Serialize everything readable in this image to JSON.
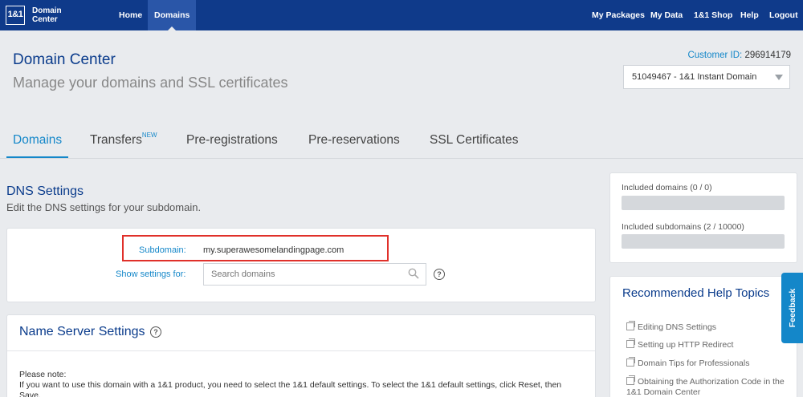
{
  "topnav": {
    "logo": "1&1",
    "brand": "Domain Center",
    "left_items": [
      {
        "label": "Home"
      },
      {
        "label": "Domains",
        "active": true
      }
    ],
    "right_items": [
      {
        "label": "My Packages"
      },
      {
        "label": "My Data"
      },
      {
        "label": "1&1 Shop"
      },
      {
        "label": "Help"
      },
      {
        "label": "Logout"
      }
    ]
  },
  "header": {
    "title": "Domain Center",
    "subtitle": "Manage your domains and SSL certificates",
    "customer_label": "Customer ID:",
    "customer_id": "296914179",
    "package_selected": "51049467 - 1&1 Instant Domain"
  },
  "tabs": [
    {
      "label": "Domains",
      "active": true
    },
    {
      "label": "Transfers",
      "badge": "NEW"
    },
    {
      "label": "Pre-registrations"
    },
    {
      "label": "Pre-reservations"
    },
    {
      "label": "SSL Certificates"
    }
  ],
  "dns": {
    "title": "DNS Settings",
    "description": "Edit the DNS settings for your subdomain.",
    "subdomain_label": "Subdomain:",
    "subdomain_value": "my.superawesomelandingpage.com",
    "show_settings_label": "Show settings for:",
    "search_placeholder": "Search domains"
  },
  "nameserver": {
    "title": "Name Server Settings",
    "note_title": "Please note:",
    "note_text": "If you want to use this domain with a 1&1 product, you need to select the 1&1 default settings. To select the 1&1 default settings, click Reset, then Save."
  },
  "quota": {
    "domains_label": "Included domains (0 / 0)",
    "subdomains_label": "Included subdomains (2 / 10000)"
  },
  "help": {
    "title": "Recommended Help Topics",
    "links": [
      "Editing DNS Settings",
      "Setting up HTTP Redirect",
      "Domain Tips for Professionals",
      "Obtaining the Authorization Code in the 1&1 Domain Center"
    ]
  },
  "feedback_label": "Feedback",
  "colors": {
    "nav_bg": "#0f3a8a",
    "accent": "#1487c9",
    "title": "#0b3c8c",
    "highlight": "#e0302a"
  }
}
